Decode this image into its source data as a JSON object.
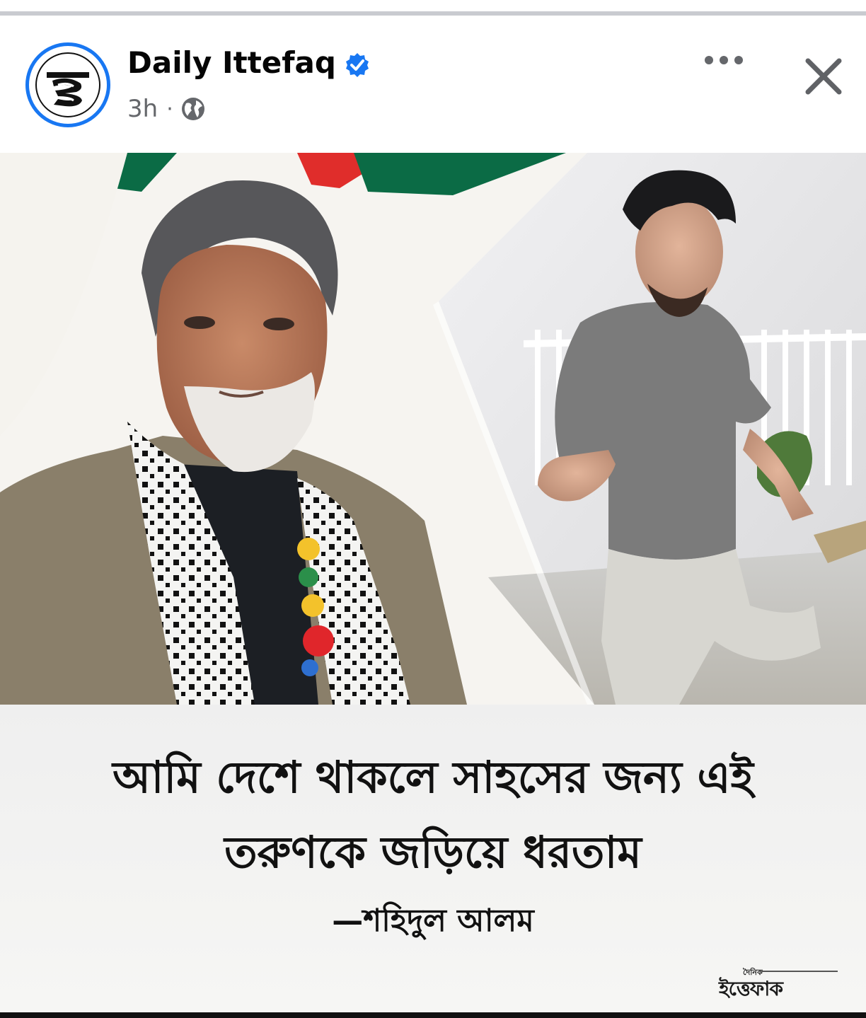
{
  "post": {
    "page_name": "Daily Ittefaq",
    "avatar_letter": "ই",
    "timestamp": "3h",
    "separator": "·",
    "verified": true,
    "privacy_icon": "globe-icon",
    "more_icon": "more-horizontal-icon",
    "close_icon": "close-icon",
    "accent_color": "#1877f2"
  },
  "image": {
    "headline_line1": "আমি দেশে থাকলে সাহসের জন্য এই",
    "headline_line2": "তরুণকে জড়িয়ে ধরতাম",
    "attribution": "—শহিদুল আলম",
    "brand_small": "দৈনিক",
    "brand_big": "ইত্তেফাক"
  }
}
